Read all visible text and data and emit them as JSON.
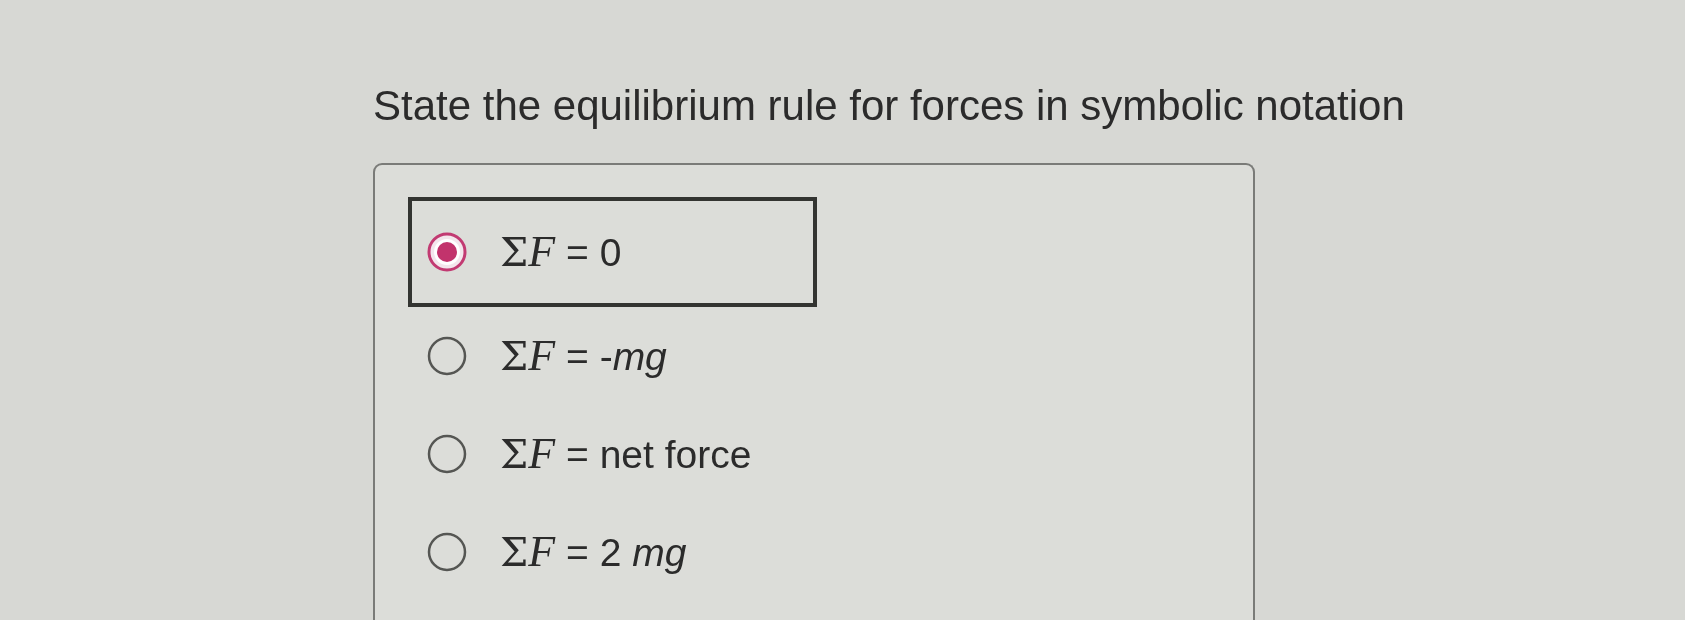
{
  "question": "State the equilibrium rule for forces in symbolic notation",
  "options": [
    {
      "sum": "Σ",
      "variable": "F",
      "equation": "= 0",
      "selected": true
    },
    {
      "sum": "Σ",
      "variable": "F",
      "equation": "= -*mg*",
      "selected": false
    },
    {
      "sum": "Σ",
      "variable": "F",
      "equation": "= net force",
      "selected": false
    },
    {
      "sum": "Σ",
      "variable": "F",
      "equation": "= 2 *mg*",
      "selected": false
    }
  ]
}
